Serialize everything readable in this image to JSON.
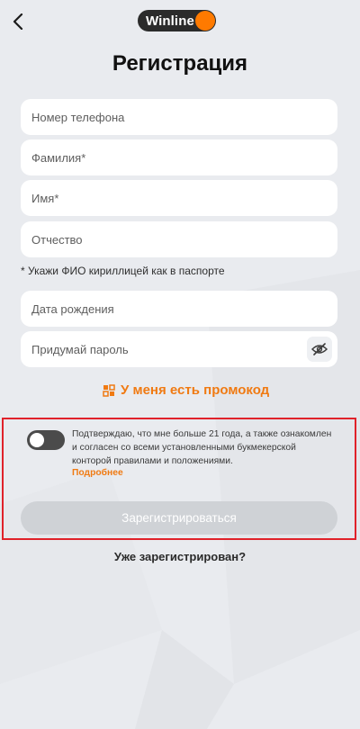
{
  "header": {
    "back_icon": "chevron-left-icon",
    "logo_text": "Winline",
    "brand_color": "#ff7a00"
  },
  "title": "Регистрация",
  "form": {
    "phone_placeholder": "Номер телефона",
    "surname_placeholder": "Фамилия*",
    "name_placeholder": "Имя*",
    "patronymic_placeholder": "Отчество",
    "fio_hint": "* Укажи ФИО кириллицей как в паспорте",
    "birthdate_placeholder": "Дата рождения",
    "password_placeholder": "Придумай пароль",
    "password_visibility_icon": "eye-off-icon"
  },
  "promo": {
    "label": "У меня есть промокод",
    "icon": "promo-code-icon",
    "color": "#f07a12"
  },
  "consent": {
    "toggle_on": false,
    "text": "Подтверждаю, что мне больше 21 года, а также ознакомлен и согласен со всеми установленными букмекерской конторой правилами и положениями.",
    "more_link": "Подробнее"
  },
  "register_button": {
    "label": "Зарегистрироваться",
    "enabled": false
  },
  "login_link": "Уже зарегистрирован?",
  "highlight_color": "#e0222a"
}
